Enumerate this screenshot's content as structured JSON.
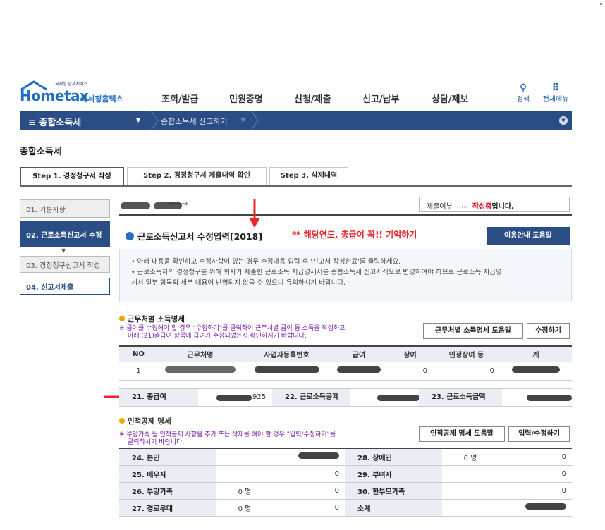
{
  "header": {
    "logo_sub": "국세청 납세서비스",
    "logo_text": "Hometax",
    "logo_kr": "국세청홈택스",
    "menu": [
      "조회/발급",
      "민원증명",
      "신청/제출",
      "신고/납부",
      "상담/제보"
    ],
    "search_label": "검색",
    "allmenu_label": "전체메뉴"
  },
  "navbar": {
    "main": "≡  종합소득세",
    "sub": "종합소득세 신고하기",
    "star": "★"
  },
  "page_title": "종합소득세",
  "tabs": [
    "Step 1. 경정청구서 작성",
    "Step 2. 경정청구서 제출내역 확인",
    "Step 3. 삭제내역"
  ],
  "steps": [
    "01. 기본사항",
    "02. 근로소득신고서 수정",
    "03. 경정청구신고서 작성",
    "04. 신고서제출"
  ],
  "masked_id": "******",
  "submit_status": {
    "label": "제출여부",
    "arrows": "›››››",
    "status": "작성중",
    "tail": "입니다."
  },
  "section": {
    "title": "근로소득신고서 수정입력[2018]",
    "annotation": "** 해당연도, 총급여 꼭!! 기억하기",
    "help_button": "이용안내 도움말"
  },
  "info": [
    "• 아래 내용을 확인하고 수정사항이 있는 경우 수정내용 입력 후 '신고서 작성완료'를 클릭하세요.",
    "• 근로소득자의 경정청구를 위해 회사가 제출한 근로소득 지급명세서를 종합소득세 신고서식으로 변경하여야 하므로 근로소득 지급명",
    "   세서 일부 항목의 세부 내용이 반영되지 않을 수 있으니 유의하시기 바랍니다."
  ],
  "work": {
    "heading": "근무처별 소득명세",
    "note1": "※ 급여를 수정해야 할 경우 \"수정하기\"를 클릭하여 근무처별 급여 등 소득을 작성하고",
    "note2": "아래 (21)총급여 항목에 급여가 수정되었는지 확인하시기 바랍니다.",
    "help_button": "근무처별 소득명세 도움말",
    "edit_button": "수정하기",
    "columns": [
      "NO",
      "근무처명",
      "사업자등록번호",
      "급여",
      "상여",
      "인정상여 등",
      "계"
    ],
    "row": {
      "no": "1",
      "bonus": "0",
      "recognized": "0"
    }
  },
  "summary": {
    "l21": "21. 총급여",
    "v21": "925",
    "l22": "22. 근로소득공제",
    "l23": "23. 근로소득금액"
  },
  "deduct": {
    "heading": "인적공제 명세",
    "note1": "※ 부양가족 등 인적공제 사항을 추가 또는 삭제를 해야 할 경우 \"입력/수정하기\"를",
    "note2": "클릭하시기 바랍니다.",
    "help_button": "인적공제 명세 도움말",
    "edit_button": "입력/수정하기",
    "rows": [
      {
        "l1": "24. 본인",
        "c1": "",
        "v1": "",
        "l2": "28. 장애인",
        "c2": "0 명",
        "v2": "0"
      },
      {
        "l1": "25. 배우자",
        "c1": "",
        "v1": "0",
        "l2": "29. 부녀자",
        "c2": "",
        "v2": "0"
      },
      {
        "l1": "26. 부양가족",
        "c1": "0 명",
        "v1": "0",
        "l2": "30. 한부모가족",
        "c2": "",
        "v2": "0"
      },
      {
        "l1": "27. 경로우대",
        "c1": "0 명",
        "v1": "0",
        "l2": "소계",
        "c2": "",
        "v2": ""
      }
    ]
  },
  "colors": {
    "navy": "#2a4d86",
    "red": "#e8262c",
    "orange": "#f0a500"
  }
}
